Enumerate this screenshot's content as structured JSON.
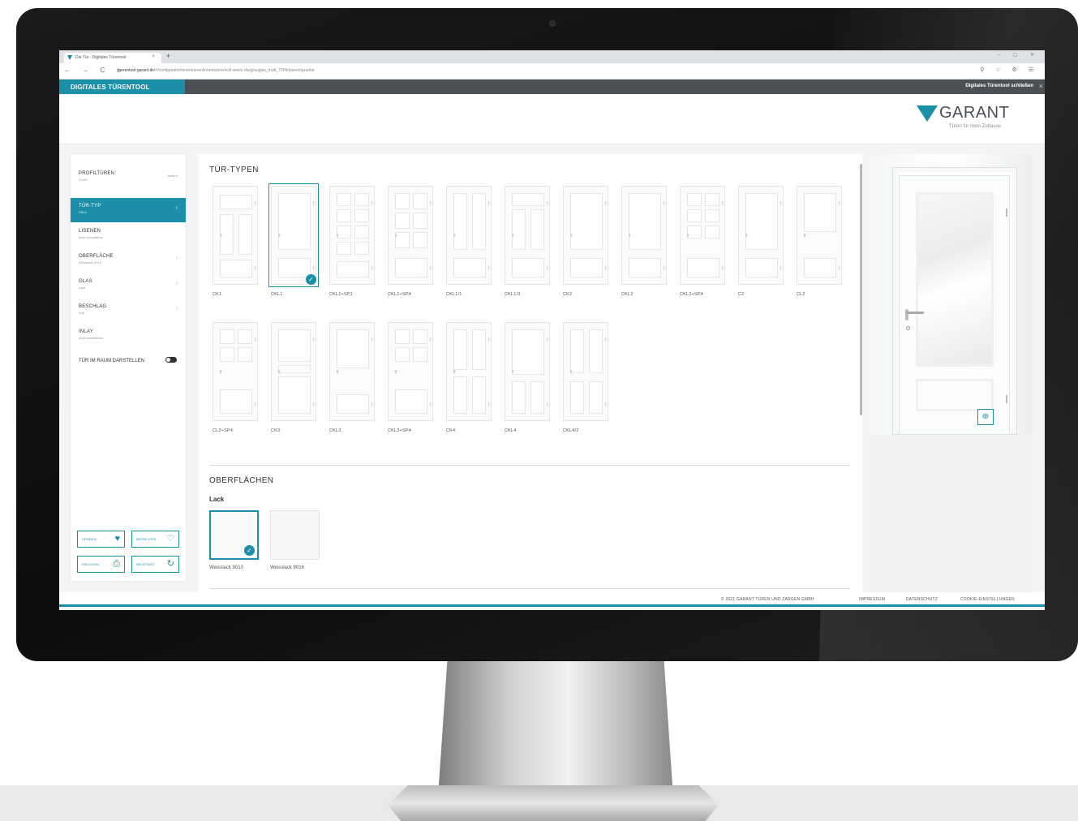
{
  "browser": {
    "tab_title": "Die Tür - Digitales Türentool",
    "tab_close": "×",
    "new_tab": "+",
    "window_controls": "– ▢ ✕",
    "nav_icons": "← → C ⌂",
    "url_host": "tuerentool-garant.de",
    "url_path": "/#/configurator/innentueren/innentueren/ckl-weiss-dw/grauglas_matt_7004/planet/quadrat",
    "toolbar_icons": "⚲ ☆ ⚙ ☰"
  },
  "app": {
    "title": "DIGITALES TÜRENTOOL",
    "close_label": "Digitales Türentool schließen",
    "close_icon": "×"
  },
  "brand": {
    "name": "GARANT",
    "tagline": "Türen für mein Zuhause",
    "accent_color": "#1b8ea8"
  },
  "sidebar": {
    "items": [
      {
        "label": "PROFILTÜREN",
        "sub": "CUBE",
        "aside": "ändern",
        "chevron": ""
      },
      {
        "label": "TÜR-TYP",
        "sub": "CKL1",
        "aside": "",
        "chevron": "›"
      },
      {
        "label": "LISENEN",
        "sub": "nicht auswählbar",
        "aside": "",
        "chevron": ""
      },
      {
        "label": "OBERFLÄCHE",
        "sub": "Weisslack 9010",
        "aside": "",
        "chevron": "›"
      },
      {
        "label": "GLAS",
        "sub": "Lipsi",
        "aside": "",
        "chevron": "›"
      },
      {
        "label": "BESCHLAG",
        "sub": "Soft",
        "aside": "",
        "chevron": "›"
      },
      {
        "label": "INLAY",
        "sub": "nicht auswählbar",
        "aside": "",
        "chevron": ""
      }
    ],
    "toggle_label": "TÜR IM RAUM DARSTELLEN",
    "buttons": [
      {
        "label": "SENDEN",
        "icon": "heart-icon",
        "glyph": "♥"
      },
      {
        "label": "MERKLISTE",
        "icon": "heart-outline-icon",
        "glyph": "♡"
      },
      {
        "label": "DRUCKEN",
        "icon": "printer-icon",
        "glyph": "⎙"
      },
      {
        "label": "NEUSTART",
        "icon": "restart-icon",
        "glyph": "↻"
      }
    ]
  },
  "main": {
    "door_types_title": "TÜR-TYPEN",
    "door_types": [
      "CK1",
      "CKL1",
      "CKL1+SP1",
      "CKL1+SP4",
      "CKL1/1",
      "CKL1/3",
      "CK2",
      "CKL2",
      "CKL2+SP4",
      "C2",
      "CL2",
      "CL2+SP4",
      "CK3",
      "CKL3",
      "CKL3+SP4",
      "CK4",
      "CKL4",
      "CKL4/2"
    ],
    "selected_door_type": "CKL1",
    "surfaces_title": "OBERFLÄCHEN",
    "surfaces_subhead": "Lack",
    "surfaces": [
      "Weisslack 9010",
      "Weisslack 9016"
    ],
    "selected_surface": "Weisslack 9010",
    "check_glyph": "✓"
  },
  "preview": {
    "zoom_glyph": "⊕"
  },
  "footer": {
    "copyright": "© 2021 GARANT TÜREN UND ZARGEN GMBH",
    "links": [
      "IMPRESSUM",
      "DATENSCHUTZ",
      "COOKIE-EINSTELLUNGEN"
    ]
  }
}
